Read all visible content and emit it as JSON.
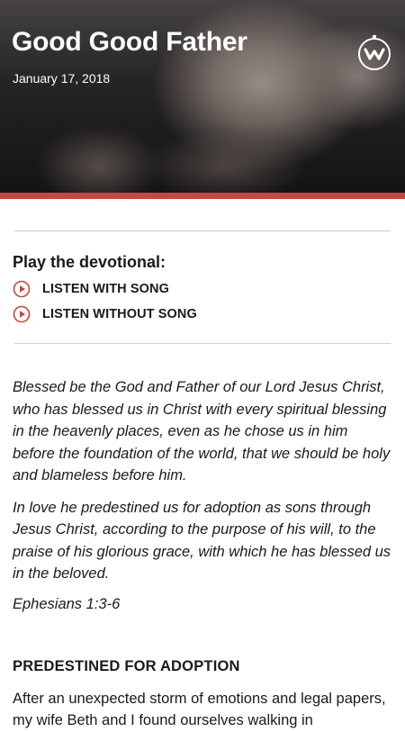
{
  "hero": {
    "title": "Good Good Father",
    "date": "January 17, 2018",
    "logo_icon": "ministry-logo-icon"
  },
  "accent_color": "#c8463f",
  "play": {
    "heading": "Play the devotional:",
    "links": [
      {
        "label": "LISTEN WITH SONG",
        "icon": "play-circle-icon"
      },
      {
        "label": "LISTEN WITHOUT SONG",
        "icon": "play-circle-icon"
      }
    ]
  },
  "scripture": {
    "paragraphs": [
      "Blessed be the God and Father of our Lord Jesus Christ, who has blessed us in Christ with every spiritual blessing in the heavenly places, even as he chose us in him before the foundation of the world, that we should be holy and blameless before him.",
      "In love he predestined us for adoption as sons through Jesus Christ, according to the purpose of his will, to the praise of his glorious grace, with which he has blessed us in the beloved."
    ],
    "reference": "Ephesians 1:3-6"
  },
  "section": {
    "heading": "PREDESTINED FOR ADOPTION",
    "body": " After an unexpected storm of emotions and legal papers, my wife Beth and I found ourselves walking in"
  }
}
